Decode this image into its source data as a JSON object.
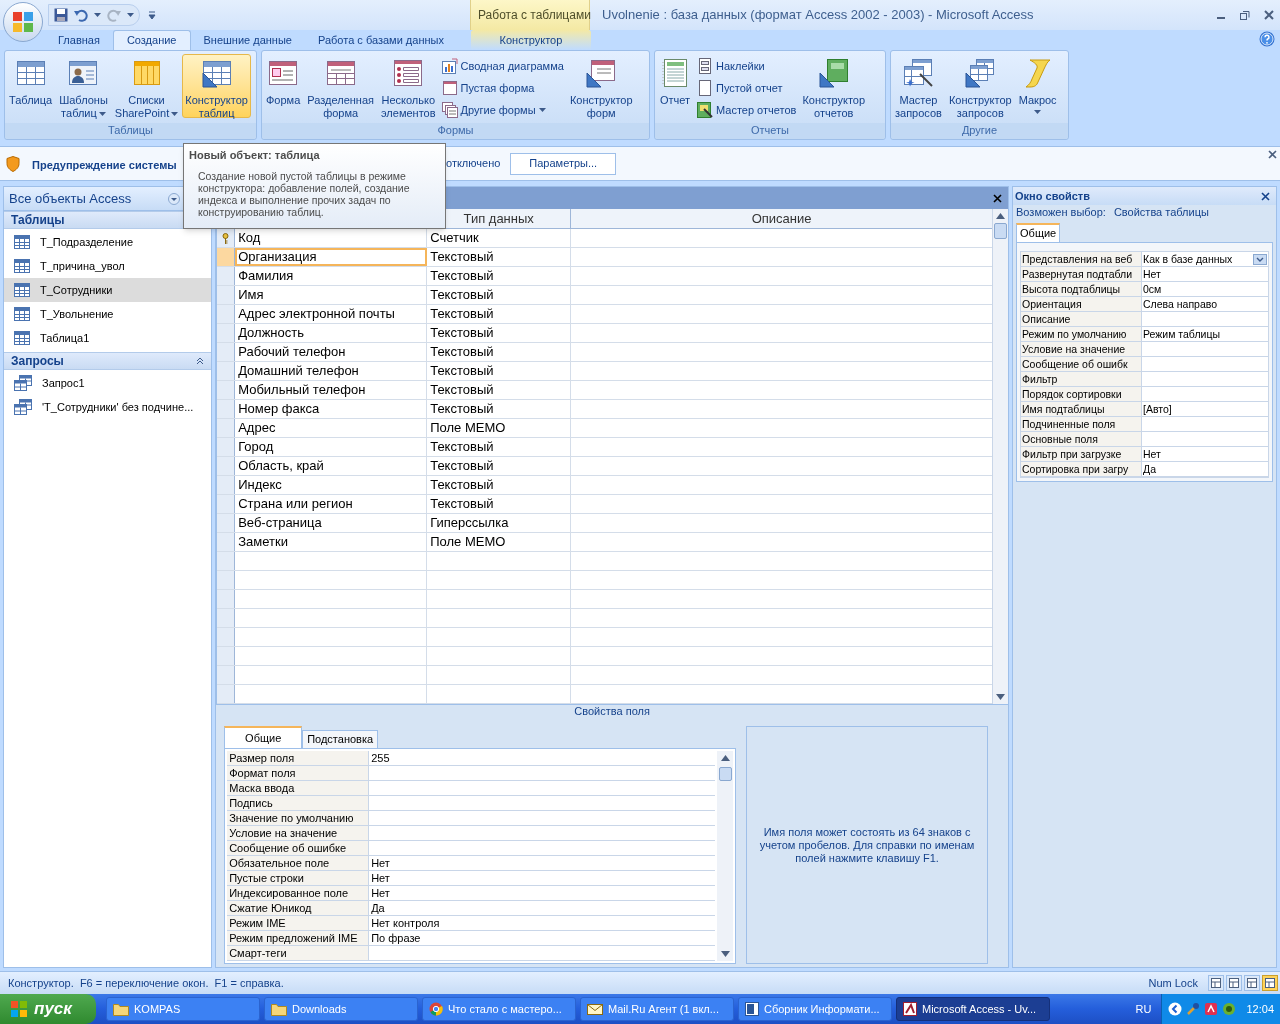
{
  "window": {
    "title": "Uvolnenie : база данных (формат Access 2002 - 2003) - Microsoft Access",
    "context_group": "Работа с таблицами"
  },
  "tabs": [
    {
      "label": "Главная",
      "selected": false
    },
    {
      "label": "Создание",
      "selected": true
    },
    {
      "label": "Внешние данные",
      "selected": false
    },
    {
      "label": "Работа с базами данных",
      "selected": false
    },
    {
      "label": "Конструктор",
      "selected": false,
      "kind": "context"
    }
  ],
  "ribbon_groups": [
    {
      "label": "Таблицы",
      "items": [
        {
          "kind": "large",
          "lines": [
            "Таблица"
          ],
          "highlighted": false,
          "dropdown": false
        },
        {
          "kind": "large",
          "lines": [
            "Шаблоны",
            "таблиц"
          ],
          "highlighted": false,
          "dropdown": true
        },
        {
          "kind": "large",
          "lines": [
            "Списки",
            "SharePoint"
          ],
          "highlighted": false,
          "dropdown": true
        },
        {
          "kind": "large",
          "lines": [
            "Конструктор",
            "таблиц"
          ],
          "highlighted": true,
          "dropdown": false
        }
      ]
    },
    {
      "label": "Формы",
      "items": [
        {
          "kind": "large",
          "lines": [
            "Форма"
          ],
          "highlighted": false,
          "dropdown": false
        },
        {
          "kind": "large",
          "lines": [
            "Разделенная",
            "форма"
          ],
          "highlighted": false,
          "dropdown": false
        },
        {
          "kind": "large",
          "lines": [
            "Несколько",
            "элементов"
          ],
          "highlighted": false,
          "dropdown": false
        },
        {
          "kind": "stack",
          "entries": [
            {
              "label": "Сводная диаграмма",
              "dropdown": false
            },
            {
              "label": "Пустая форма",
              "dropdown": false
            },
            {
              "label": "Другие формы",
              "dropdown": true
            }
          ]
        },
        {
          "kind": "large",
          "lines": [
            "Конструктор",
            "форм"
          ],
          "highlighted": false,
          "dropdown": false
        }
      ]
    },
    {
      "label": "Отчеты",
      "items": [
        {
          "kind": "large",
          "lines": [
            "Отчет"
          ],
          "highlighted": false,
          "dropdown": false
        },
        {
          "kind": "stack",
          "entries": [
            {
              "label": "Наклейки",
              "dropdown": false
            },
            {
              "label": "Пустой отчет",
              "dropdown": false
            },
            {
              "label": "Мастер отчетов",
              "dropdown": false
            }
          ]
        },
        {
          "kind": "large",
          "lines": [
            "Конструктор",
            "отчетов"
          ],
          "highlighted": false,
          "dropdown": false
        }
      ]
    },
    {
      "label": "Другие",
      "items": [
        {
          "kind": "large",
          "lines": [
            "Мастер",
            "запросов"
          ],
          "highlighted": false,
          "dropdown": false
        },
        {
          "kind": "large",
          "lines": [
            "Конструктор",
            "запросов"
          ],
          "highlighted": false,
          "dropdown": false
        },
        {
          "kind": "large",
          "lines": [
            "Макрос"
          ],
          "highlighted": false,
          "dropdown": true
        }
      ]
    }
  ],
  "warning_bar": {
    "text": "Предупреждение системы",
    "status": "отключено",
    "button": "Параметры..."
  },
  "tooltip": {
    "title": "Новый объект: таблица",
    "text": "Создание новой пустой таблицы в режиме конструктора: добавление полей, создание индекса и выполнение прочих задач по конструированию таблиц."
  },
  "nav_pane": {
    "title": "Все объекты Access",
    "sections": [
      {
        "label": "Таблицы",
        "kind": "table",
        "collapsible": false,
        "items": [
          {
            "label": "Т_Подразделение",
            "selected": false
          },
          {
            "label": "Т_причина_увол",
            "selected": false
          },
          {
            "label": "Т_Сотрудники",
            "selected": true
          },
          {
            "label": "Т_Увольнение",
            "selected": false
          },
          {
            "label": "Таблица1",
            "selected": false
          }
        ]
      },
      {
        "label": "Запросы",
        "kind": "query",
        "collapsible": true,
        "items": [
          {
            "label": "Запрос1",
            "selected": false
          },
          {
            "label": "'Т_Сотрудники' без подчине...",
            "selected": false
          }
        ]
      }
    ]
  },
  "design_grid": {
    "column_headers": [
      "Тип данных",
      "Описание"
    ],
    "rows": [
      {
        "name": "Код",
        "type": "Счетчик",
        "primary_key": true,
        "current": false
      },
      {
        "name": "Организация",
        "type": "Текстовый",
        "primary_key": false,
        "current": true
      },
      {
        "name": "Фамилия",
        "type": "Текстовый",
        "primary_key": false,
        "current": false
      },
      {
        "name": "Имя",
        "type": "Текстовый",
        "primary_key": false,
        "current": false
      },
      {
        "name": "Адрес электронной почты",
        "type": "Текстовый",
        "primary_key": false,
        "current": false
      },
      {
        "name": "Должность",
        "type": "Текстовый",
        "primary_key": false,
        "current": false
      },
      {
        "name": "Рабочий телефон",
        "type": "Текстовый",
        "primary_key": false,
        "current": false
      },
      {
        "name": "Домашний телефон",
        "type": "Текстовый",
        "primary_key": false,
        "current": false
      },
      {
        "name": "Мобильный телефон",
        "type": "Текстовый",
        "primary_key": false,
        "current": false
      },
      {
        "name": "Номер факса",
        "type": "Текстовый",
        "primary_key": false,
        "current": false
      },
      {
        "name": "Адрес",
        "type": "Поле MEMO",
        "primary_key": false,
        "current": false
      },
      {
        "name": "Город",
        "type": "Текстовый",
        "primary_key": false,
        "current": false
      },
      {
        "name": "Область, край",
        "type": "Текстовый",
        "primary_key": false,
        "current": false
      },
      {
        "name": "Индекс",
        "type": "Текстовый",
        "primary_key": false,
        "current": false
      },
      {
        "name": "Страна или регион",
        "type": "Текстовый",
        "primary_key": false,
        "current": false
      },
      {
        "name": "Веб-страница",
        "type": "Гиперссылка",
        "primary_key": false,
        "current": false
      },
      {
        "name": "Заметки",
        "type": "Поле MEMO",
        "primary_key": false,
        "current": false
      }
    ]
  },
  "field_properties": {
    "title": "Свойства поля",
    "tabs": [
      {
        "label": "Общие",
        "selected": true
      },
      {
        "label": "Подстановка",
        "selected": false
      }
    ],
    "rows": [
      {
        "name": "Размер поля",
        "value": "255"
      },
      {
        "name": "Формат поля"
      },
      {
        "name": "Маска ввода"
      },
      {
        "name": "Подпись"
      },
      {
        "name": "Значение по умолчанию"
      },
      {
        "name": "Условие на значение"
      },
      {
        "name": "Сообщение об ошибке"
      },
      {
        "name": "Обязательное поле",
        "value": "Нет"
      },
      {
        "name": "Пустые строки",
        "value": "Нет"
      },
      {
        "name": "Индексированное поле",
        "value": "Нет"
      },
      {
        "name": "Сжатие Юникод",
        "value": "Да"
      },
      {
        "name": "Режим IME",
        "value": "Нет контроля"
      },
      {
        "name": "Режим предложений IME",
        "value": "По фразе"
      },
      {
        "name": "Смарт-теги"
      }
    ],
    "help": "Имя поля может состоять из 64 знаков с учетом пробелов.  Для справки по именам полей нажмите клавишу F1."
  },
  "property_sheet": {
    "title": "Окно свойств",
    "selection_label": "Возможен выбор:",
    "selection_value": "Свойства таблицы",
    "tab": "Общие",
    "rows": [
      {
        "name": "Представления на веб",
        "value": "Как в базе данных",
        "dropdown": true
      },
      {
        "name": "Развернутая подтабли",
        "value": "Нет",
        "dropdown": false
      },
      {
        "name": "Высота подтаблицы",
        "value": "0см",
        "dropdown": false
      },
      {
        "name": "Ориентация",
        "value": "Слева направо",
        "dropdown": false
      },
      {
        "name": "Описание",
        "dropdown": false
      },
      {
        "name": "Режим по умолчанию",
        "value": "Режим таблицы",
        "dropdown": false
      },
      {
        "name": "Условие на значение",
        "dropdown": false
      },
      {
        "name": "Сообщение об ошибк",
        "dropdown": false
      },
      {
        "name": "Фильтр",
        "dropdown": false
      },
      {
        "name": "Порядок сортировки",
        "dropdown": false
      },
      {
        "name": "Имя подтаблицы",
        "value": "[Авто]",
        "dropdown": false
      },
      {
        "name": "Подчиненные поля",
        "dropdown": false
      },
      {
        "name": "Основные поля",
        "dropdown": false
      },
      {
        "name": "Фильтр при загрузке",
        "value": "Нет",
        "dropdown": false
      },
      {
        "name": "Сортировка при загру",
        "value": "Да",
        "dropdown": false
      }
    ]
  },
  "status_bar": {
    "text": "Конструктор.  F6 = переключение окон.  F1 = справка.",
    "num_lock": "Num Lock",
    "views": [
      {
        "selected": false
      },
      {
        "selected": false
      },
      {
        "selected": false
      },
      {
        "selected": true
      }
    ]
  },
  "taskbar": {
    "start": "пуск",
    "tasks": [
      {
        "label": "KOMPAS",
        "kind": "folder",
        "selected": false
      },
      {
        "label": "Downloads",
        "kind": "folder",
        "selected": false
      },
      {
        "label": "Что стало с мастеро...",
        "kind": "browser",
        "selected": false
      },
      {
        "label": "Mail.Ru Агент (1 вкл...",
        "kind": "mail",
        "selected": false
      },
      {
        "label": "Сборник Информати...",
        "kind": "document",
        "selected": false
      },
      {
        "label": "Microsoft Access - Uv...",
        "kind": "access",
        "selected": true
      }
    ],
    "language": "RU",
    "time": "12:04"
  }
}
